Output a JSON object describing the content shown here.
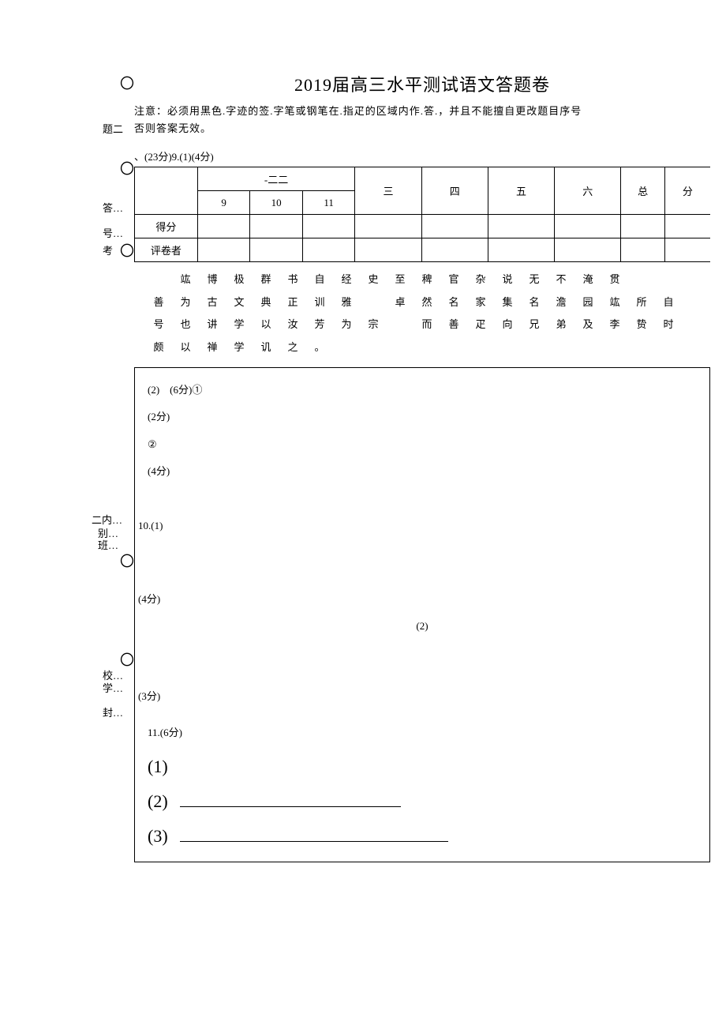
{
  "left": {
    "lbl_ti2": "题二",
    "lbl_da": "答…",
    "lbl_hao": "号…",
    "lbl_kao": "考",
    "lbl_ernei": "二内…",
    "lbl_bie": "别…",
    "lbl_ban": "班…",
    "lbl_xiao": "校…",
    "lbl_xue": "学…",
    "lbl_feng": "封…"
  },
  "title": "2019届高三水平测试语文答题卷",
  "notice_line1": "注意：必须用黑色.字迹的签.字笔或钢笔在.指疋的区域内作.答.，并且不能擅自更改题目序号",
  "notice_line2": "否则答案无效。",
  "section": "、(23分)9.(1)(4分)",
  "table": {
    "col_first": "",
    "col_22": "-二二",
    "col_san": "三",
    "col_si": "四",
    "col_wu": "五",
    "col_liu": "六",
    "col_zong": "总",
    "col_fen": "分",
    "sub9": "9",
    "sub10": "10",
    "sub11": "11",
    "row_defen": "得分",
    "row_pingjuan": "评卷者"
  },
  "chinese": {
    "l1": [
      "竑",
      "博",
      "极",
      "群",
      "书",
      "自",
      "经",
      "史",
      "至",
      "稗",
      "官",
      "杂",
      "说",
      "无",
      "不",
      "淹",
      "贯"
    ],
    "l2": [
      "善",
      "为",
      "古",
      "文",
      "典",
      "正",
      "训",
      "雅",
      "",
      "卓",
      "然",
      "名",
      "家",
      "集",
      "名",
      "澹",
      "园",
      "竑",
      "所",
      "自"
    ],
    "l3": [
      "号",
      "也",
      "讲",
      "学",
      "以",
      "汝",
      "芳",
      "为",
      "宗",
      "",
      "而",
      "善",
      "疋",
      "向",
      "兄",
      "弟",
      "及",
      "李",
      "贽",
      "时"
    ],
    "l4": [
      "颇",
      "以",
      "禅",
      "学",
      "讥",
      "之",
      "。"
    ]
  },
  "ans": {
    "q2": "(2)　(6分)①",
    "pts2": "(2分)",
    "circ2": "②",
    "pts4": "(4分)",
    "q10_1": "10.(1)",
    "q10_2": "(2)",
    "pts3": "(3分)",
    "q11": "11.(6分)",
    "sub1": "(1)",
    "sub2": "(2)",
    "sub3": "(3)"
  }
}
